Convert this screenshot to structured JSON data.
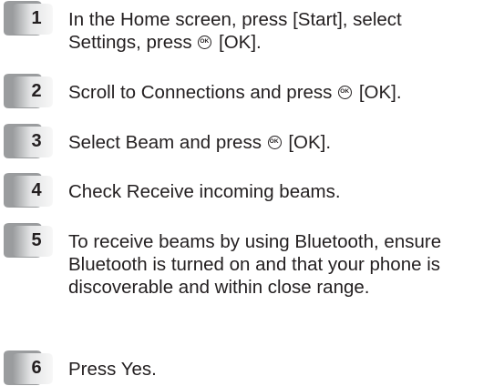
{
  "steps": [
    {
      "number": "1",
      "lines": [
        {
          "before": "In the Home screen, press [Start], select",
          "after": ""
        },
        {
          "before": "Settings, press",
          "after": "[OK]."
        }
      ]
    },
    {
      "number": "2",
      "lines": [
        {
          "before": "Scroll to Connections and press",
          "after": "[OK]."
        }
      ]
    },
    {
      "number": "3",
      "lines": [
        {
          "before": "Select Beam and press",
          "after": "[OK]."
        }
      ]
    },
    {
      "number": "4",
      "lines": [
        {
          "before": "Check Receive incoming beams.",
          "after": ""
        }
      ]
    },
    {
      "number": "5",
      "lines": [
        {
          "before": "To receive beams by using Bluetooth, ensure",
          "after": ""
        },
        {
          "before": "Bluetooth is turned on and that your phone is",
          "after": ""
        },
        {
          "before": "discoverable and within close range.",
          "after": ""
        }
      ]
    },
    {
      "number": "6",
      "lines": [
        {
          "before": "Press Yes.",
          "after": ""
        }
      ]
    }
  ],
  "ok_key": {
    "icon": "ok-key-icon",
    "glyph": "OK"
  },
  "colors": {
    "badge_fill_dark": "#9a9c9e",
    "badge_fill_light": "#e4e5e6",
    "badge_highlight": "#f7f7f7",
    "text": "#231f20"
  }
}
